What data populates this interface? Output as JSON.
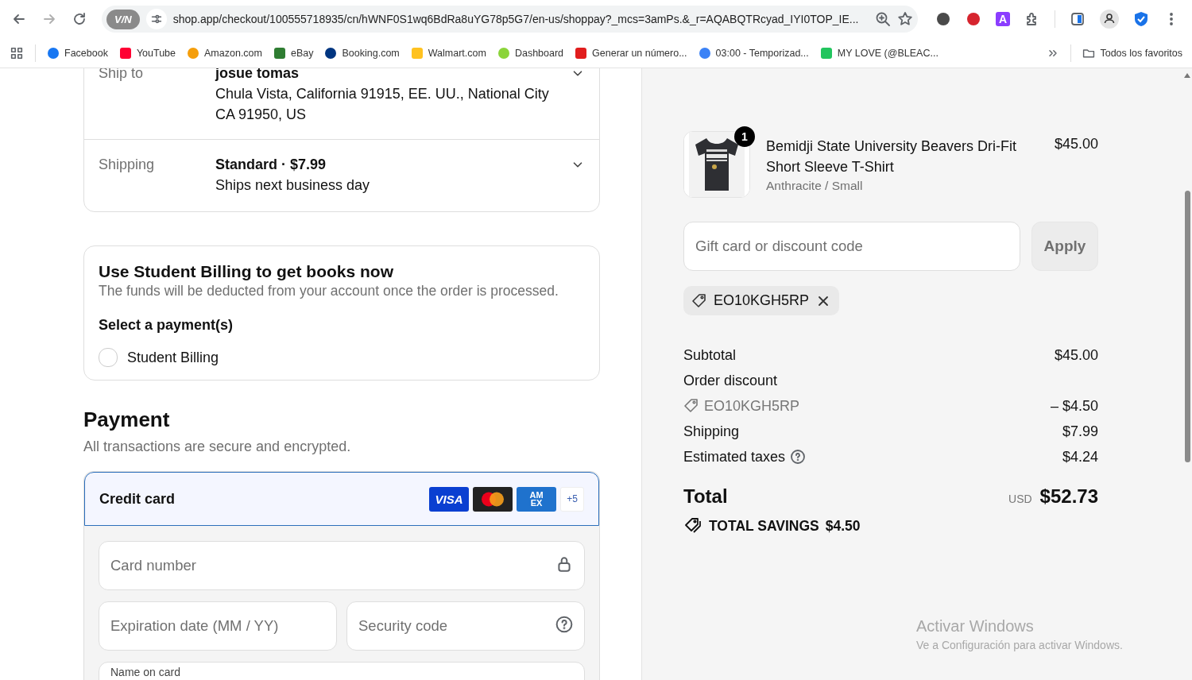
{
  "browser": {
    "vpn_badge": "V/N",
    "address": "shop.app/checkout/100555718935/cn/hWNF0S1wq6BdRa8uYG78p5G7/en-us/shoppay?_mcs=3amPs.&_r=AQABQTRcyad_IYI0TOP_IE...",
    "extension_letter": "A",
    "bookmarks": [
      {
        "label": "Facebook",
        "color": "#1877f2"
      },
      {
        "label": "YouTube",
        "color": "#ff0033"
      },
      {
        "label": "Amazon.com",
        "color": "#f59e0b"
      },
      {
        "label": "eBay",
        "color": "#2f7d32"
      },
      {
        "label": "Booking.com",
        "color": "#003580"
      },
      {
        "label": "Walmart.com",
        "color": "#ffc220"
      },
      {
        "label": "Dashboard",
        "color": "#8bd43a"
      },
      {
        "label": "Generar un número...",
        "color": "#e11d1d"
      },
      {
        "label": "03:00 - Temporizad...",
        "color": "#3b82f6"
      },
      {
        "label": "MY LOVE (@BLEAC...",
        "color": "#22c55e"
      }
    ],
    "all_bookmarks": "Todos los favoritos"
  },
  "shipping_summary": {
    "rows": [
      {
        "label": "Ship to",
        "lines": [
          "josue tomas",
          "Chula Vista, California 91915, EE. UU., National City",
          "CA 91950, US"
        ]
      },
      {
        "label": "Shipping",
        "lines": [
          "Standard · $7.99",
          "Ships next business day"
        ]
      }
    ]
  },
  "student_billing": {
    "title": "Use Student Billing to get books now",
    "description": "The funds will be deducted from your account once the order is processed.",
    "select_label": "Select a payment(s)",
    "options": [
      {
        "label": "Student Billing",
        "checked": false
      }
    ]
  },
  "payment": {
    "title": "Payment",
    "subtitle": "All transactions are secure and encrypted.",
    "methods": [
      {
        "label": "Credit card",
        "selected": true,
        "brands": [
          {
            "kind": "visa",
            "label": "VISA"
          },
          {
            "kind": "mastercard"
          },
          {
            "kind": "amex",
            "label": "AM EX"
          }
        ],
        "more_brands": "+5"
      }
    ],
    "fields": [
      {
        "kind": "lock",
        "placeholder": "Card number"
      },
      {
        "kind": "plain",
        "placeholder": "Expiration date (MM / YY)"
      },
      {
        "kind": "help",
        "placeholder": "Security code"
      },
      {
        "kind": "floating",
        "label": "Name on card"
      }
    ]
  },
  "order": {
    "items": [
      {
        "title": "Bemidji State University Beavers Dri-Fit Short Sleeve T-Shirt",
        "variant": "Anthracite / Small",
        "price": "$45.00",
        "quantity": "1"
      }
    ],
    "discount": {
      "placeholder": "Gift card or discount code",
      "apply": "Apply"
    },
    "applied_codes": [
      "EO10KGH5RP"
    ],
    "lines": [
      {
        "kind": "plain",
        "label": "Subtotal",
        "value": "$45.00"
      },
      {
        "kind": "plain",
        "label": "Order discount"
      },
      {
        "kind": "code",
        "label": "EO10KGH5RP",
        "value": "– $4.50"
      },
      {
        "kind": "plain",
        "label": "Shipping",
        "value": "$7.99"
      },
      {
        "kind": "info",
        "label": "Estimated taxes",
        "value": "$4.24"
      }
    ],
    "total": {
      "label": "Total",
      "currency": "USD",
      "amount": "$52.73"
    },
    "savings": {
      "label": "TOTAL SAVINGS",
      "amount": "$4.50"
    }
  },
  "os_notice": {
    "title": "Activar Windows",
    "text": "Ve a Configuración para activar Windows."
  }
}
